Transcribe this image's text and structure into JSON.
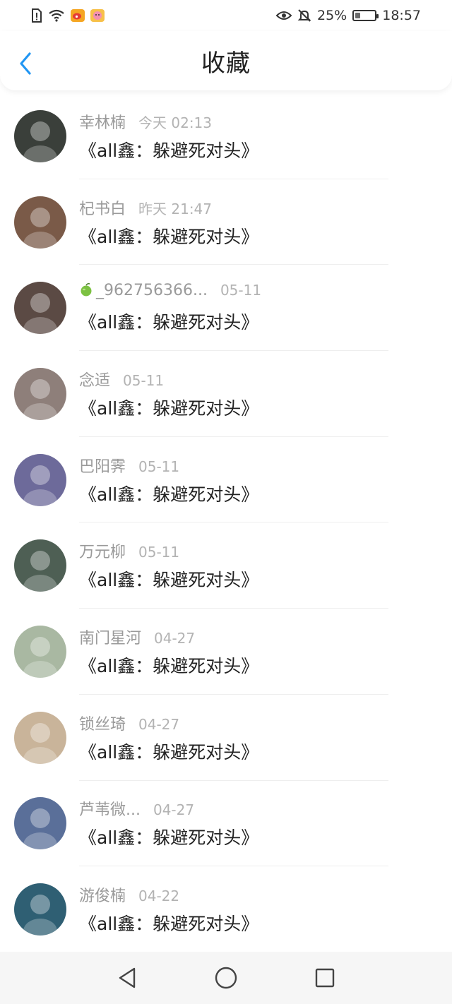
{
  "status_bar": {
    "battery_level": "25%",
    "battery_fraction": 0.25,
    "time": "18:57",
    "icons": [
      "sim-alert-icon",
      "wifi-icon",
      "weibo-icon",
      "app-notification-icon",
      "eye-icon",
      "bell-muted-icon",
      "battery-icon"
    ]
  },
  "header": {
    "back_icon": "chevron-left-icon",
    "title": "收藏",
    "accent_color": "#2196f3"
  },
  "list": {
    "items": [
      {
        "name": "幸林楠",
        "time": "今天 02:13",
        "title": "《all鑫：躲避死对头》",
        "avatar_color": "#3a3f3a"
      },
      {
        "name": "杞书白",
        "time": "昨天 21:47",
        "title": "《all鑫：躲避死对头》",
        "avatar_color": "#7a5a48"
      },
      {
        "name": "_962756366...",
        "time": "05-11",
        "title": "《all鑫：躲避死对头》",
        "avatar_color": "#5b4a44",
        "prefix_icon": "green-apple-icon"
      },
      {
        "name": "念适",
        "time": "05-11",
        "title": "《all鑫：躲避死对头》",
        "avatar_color": "#8e7f7a"
      },
      {
        "name": "巴阳霁",
        "time": "05-11",
        "title": "《all鑫：躲避死对头》",
        "avatar_color": "#6d6a9a"
      },
      {
        "name": "万元柳",
        "time": "05-11",
        "title": "《all鑫：躲避死对头》",
        "avatar_color": "#4e5f54"
      },
      {
        "name": "南门星河",
        "time": "04-27",
        "title": "《all鑫：躲避死对头》",
        "avatar_color": "#a9b8a2"
      },
      {
        "name": "锁丝琦",
        "time": "04-27",
        "title": "《all鑫：躲避死对头》",
        "avatar_color": "#c9b49a"
      },
      {
        "name": "芦苇微...",
        "time": "04-27",
        "title": "《all鑫：躲避死对头》",
        "avatar_color": "#5a6f99"
      },
      {
        "name": "游俊楠",
        "time": "04-22",
        "title": "《all鑫：躲避死对头》",
        "avatar_color": "#2f5f73"
      }
    ]
  },
  "navbar": {
    "icons": [
      "back-triangle-icon",
      "home-circle-icon",
      "recents-square-icon"
    ]
  }
}
